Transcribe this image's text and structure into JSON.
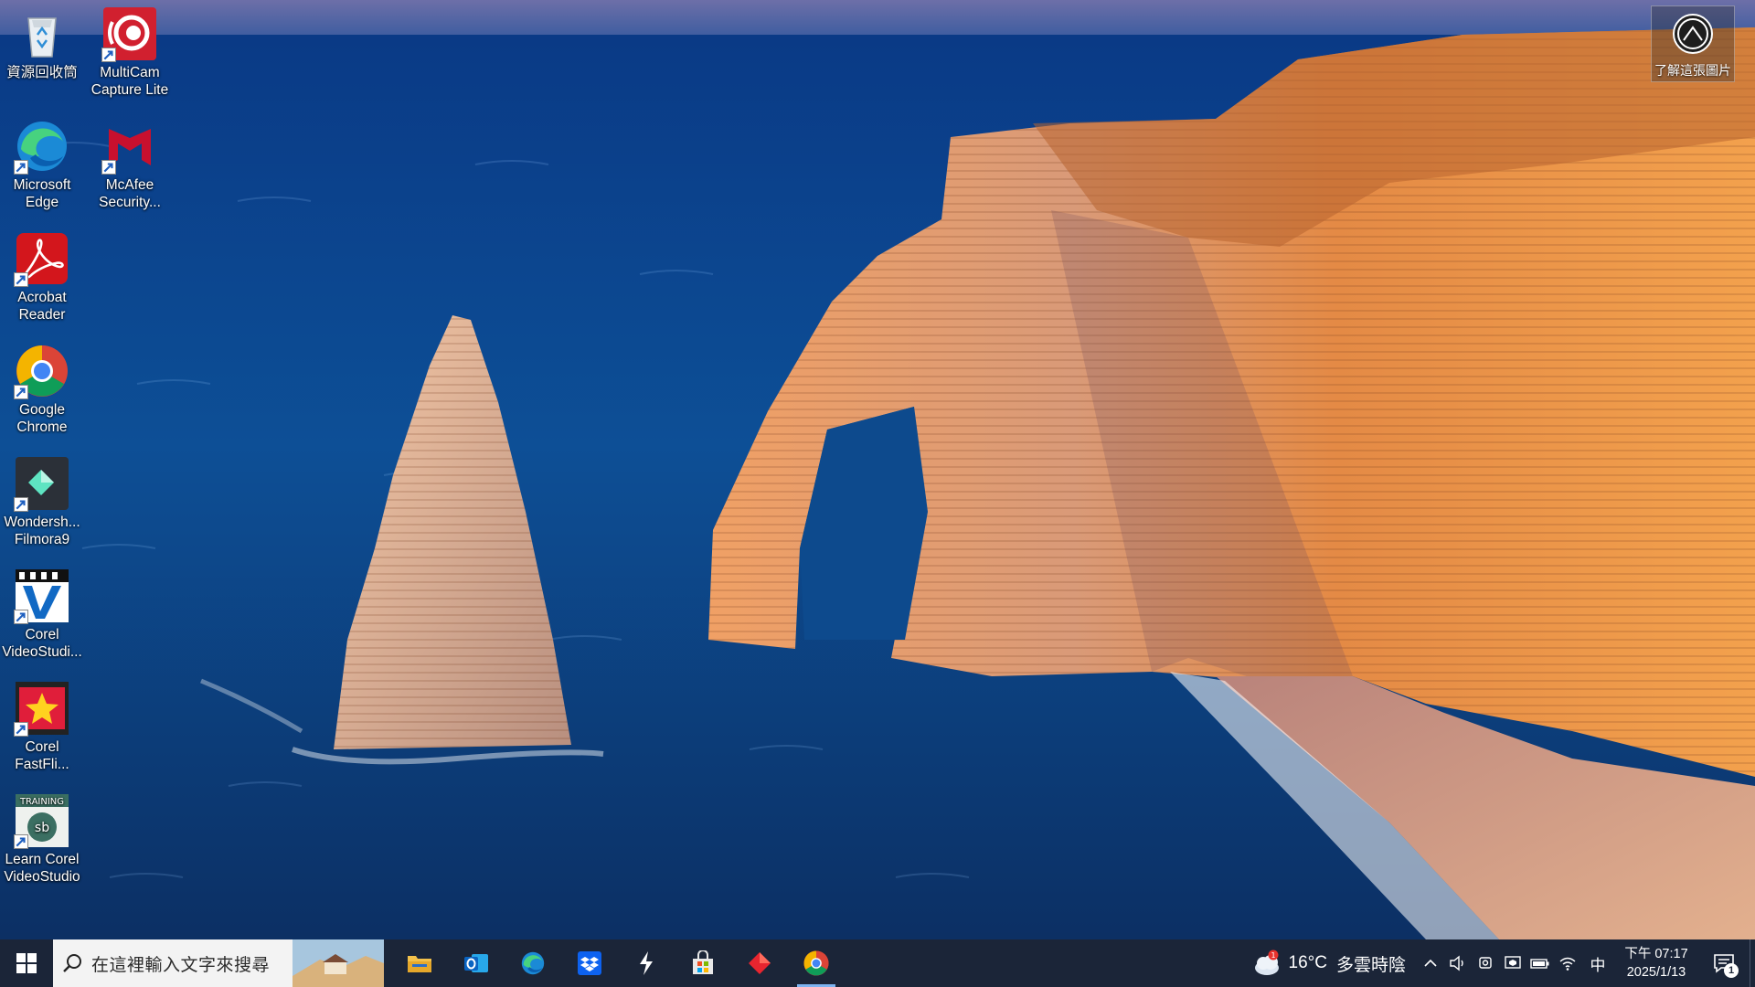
{
  "desktop": {
    "icons": [
      {
        "label": "資源回收筒",
        "icon": "recycle-bin-icon"
      },
      {
        "label": "MultiCam Capture Lite",
        "icon": "multicam-icon"
      },
      {
        "label": "Microsoft Edge",
        "icon": "edge-icon"
      },
      {
        "label": "McAfee Security...",
        "icon": "mcafee-icon"
      },
      {
        "label": "Acrobat Reader",
        "icon": "acrobat-icon"
      },
      {
        "label": "Google Chrome",
        "icon": "chrome-icon"
      },
      {
        "label": "Wondersh... Filmora9",
        "icon": "filmora-icon"
      },
      {
        "label": "Corel VideoStudi...",
        "icon": "corel-videostudio-icon"
      },
      {
        "label": "Corel FastFli...",
        "icon": "corel-fastflick-icon"
      },
      {
        "label": "Learn Corel VideoStudio",
        "icon": "learn-corel-icon"
      }
    ],
    "learn_about_picture": "了解這張圖片"
  },
  "taskbar": {
    "search_placeholder": "在這裡輸入文字來搜尋",
    "pinned": [
      {
        "name": "file-explorer",
        "icon": "folder-icon"
      },
      {
        "name": "outlook",
        "icon": "outlook-icon"
      },
      {
        "name": "edge",
        "icon": "edge-icon"
      },
      {
        "name": "dropbox",
        "icon": "dropbox-icon"
      },
      {
        "name": "lightning-app",
        "icon": "lightning-icon"
      },
      {
        "name": "microsoft-store",
        "icon": "store-icon"
      },
      {
        "name": "red-diamond-app",
        "icon": "diamond-icon"
      },
      {
        "name": "chrome",
        "icon": "chrome-icon",
        "active": true
      }
    ],
    "weather": {
      "temp": "16°C",
      "condition": "多雲時陰",
      "badge": "1"
    },
    "ime": "中",
    "clock": {
      "time": "下午 07:17",
      "date": "2025/1/13"
    },
    "notifications": "1"
  },
  "colors": {
    "taskbar_bg": "#1b2538",
    "sea_deep": "#0c3a7a",
    "cliff_orange": "#e8893e",
    "active_indicator": "#7db3f0"
  }
}
